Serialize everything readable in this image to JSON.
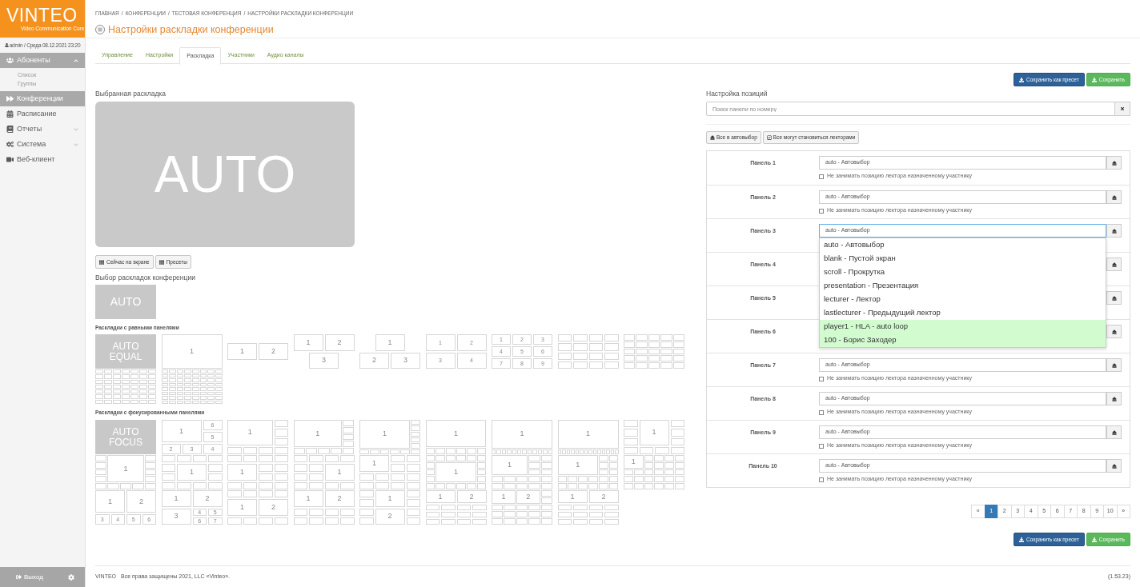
{
  "sidebar": {
    "logo": {
      "text": "VINTEO",
      "tagline": "Video Communication Core"
    },
    "user": "admin / Среда 08.12.2021 23:20",
    "nav": [
      {
        "label": "Абоненты",
        "selected": true,
        "expanded": true,
        "children": [
          {
            "label": "Список",
            "selected": false
          },
          {
            "label": "Группы",
            "selected": false
          }
        ]
      },
      {
        "label": "Конференции",
        "selected": true
      },
      {
        "label": "Расписание",
        "selected": false
      },
      {
        "label": "Отчеты",
        "selected": false,
        "expanded": false
      },
      {
        "label": "Система",
        "selected": false,
        "expanded": false
      },
      {
        "label": "Веб-клиент",
        "selected": false
      }
    ],
    "logout": "Выход"
  },
  "breadcrumb": {
    "separator": "/",
    "items": [
      "ГЛАВНАЯ",
      "КОНФЕРЕНЦИИ",
      "ТЕСТОВАЯ КОНФЕРЕНЦИЯ",
      "НАСТРОЙКИ РАСКЛАДКИ КОНФЕРЕНЦИИ"
    ]
  },
  "title": "Настройки раскладки конференции",
  "tabs": [
    {
      "label": "Управление",
      "selected": false
    },
    {
      "label": "Настройки",
      "selected": false
    },
    {
      "label": "Раскладка",
      "selected": true
    },
    {
      "label": "Участники",
      "selected": false
    },
    {
      "label": "Аудио каналы",
      "selected": false
    }
  ],
  "save_actions_top": [
    {
      "label": "Сохранить как пресет",
      "kind": "primary"
    },
    {
      "label": "Сохранить",
      "kind": "success"
    }
  ],
  "selected_layout": {
    "heading": "Выбранная раскладка",
    "preview": "AUTO",
    "buttons": [
      "Сейчас на экране",
      "Пресеты"
    ]
  },
  "layout_picker": {
    "heading": "Выбор раскладок конференции",
    "auto": "AUTO",
    "equal": {
      "label": "Раскладки с равными панелями",
      "layouts": [
        {
          "kind": "auto",
          "text": "AUTO EQUAL"
        },
        {
          "kind": "cells",
          "labels": [
            "1"
          ]
        },
        {
          "kind": "cells",
          "labels": [
            "1",
            "2"
          ]
        },
        {
          "kind": "cells",
          "labels": [
            "1",
            "2",
            "3"
          ]
        },
        {
          "kind": "cells",
          "labels": [
            "1",
            "2",
            "3"
          ]
        },
        {
          "kind": "cells",
          "labels": [
            "1",
            "2",
            "3",
            "4"
          ]
        },
        {
          "kind": "cells",
          "labels": [
            "1",
            "2",
            "3",
            "4",
            "5",
            "6",
            "7",
            "8",
            "9"
          ]
        },
        {
          "kind": "cells"
        },
        {
          "kind": "cells"
        },
        {
          "kind": "cells"
        },
        {
          "kind": "cells"
        }
      ]
    },
    "focus": {
      "label": "Раскладки с фокусированными панелями",
      "layouts": [
        {
          "kind": "auto",
          "text": "AUTO FOCUS"
        },
        {
          "kind": "cells",
          "labels": [
            "1",
            "6",
            "5",
            "2",
            "3",
            "4"
          ]
        },
        {
          "kind": "cells",
          "labels": [
            "1"
          ]
        },
        {
          "kind": "cells",
          "labels": [
            "1"
          ]
        },
        {
          "kind": "cells",
          "labels": [
            "1"
          ]
        },
        {
          "kind": "cells",
          "labels": [
            "1"
          ]
        },
        {
          "kind": "cells",
          "labels": [
            "1"
          ]
        },
        {
          "kind": "cells",
          "labels": [
            "1"
          ]
        },
        {
          "kind": "cells",
          "labels": [
            "1"
          ]
        },
        {
          "kind": "cells",
          "labels": [
            "1"
          ]
        },
        {
          "kind": "cells",
          "labels": [
            "1"
          ]
        },
        {
          "kind": "cells",
          "labels": [
            "1"
          ]
        },
        {
          "kind": "cells",
          "labels": [
            "1"
          ]
        },
        {
          "kind": "cells",
          "labels": [
            "1"
          ]
        },
        {
          "kind": "cells",
          "labels": [
            "1"
          ]
        },
        {
          "kind": "cells",
          "labels": [
            "1"
          ]
        },
        {
          "kind": "cells",
          "labels": [
            "1"
          ]
        },
        {
          "kind": "cells",
          "labels": [
            "1"
          ]
        },
        {
          "kind": "cells",
          "labels": [
            "1",
            "2",
            "3",
            "4",
            "5",
            "6"
          ]
        },
        {
          "kind": "cells",
          "labels": [
            "1",
            "2",
            "3",
            "4",
            "5",
            "6",
            "7"
          ]
        },
        {
          "kind": "cells",
          "labels": [
            "1",
            "2"
          ]
        },
        {
          "kind": "cells",
          "labels": [
            "1",
            "2"
          ]
        },
        {
          "kind": "cells",
          "labels": [
            "1",
            "2"
          ]
        },
        {
          "kind": "cells",
          "labels": [
            "1",
            "2"
          ]
        },
        {
          "kind": "cells",
          "labels": [
            "1",
            "2"
          ]
        },
        {
          "kind": "cells",
          "labels": [
            "1",
            "2"
          ]
        }
      ]
    }
  },
  "positions": {
    "heading": "Настройка позиций",
    "search": {
      "placeholder": "Поиск панели по номеру"
    },
    "bulk_actions": [
      {
        "label": "Все в автовыбор",
        "kind": "auto"
      },
      {
        "label": "Все могут становиться лекторами",
        "kind": "lecturers"
      }
    ],
    "panels": [
      {
        "label": "Панель 1",
        "value": "auto - Автовыбор",
        "focused": false,
        "option": {
          "label": "Не занимать позицию лектора назначенному участнику",
          "checked": false
        }
      },
      {
        "label": "Панель 2",
        "value": "auto - Автовыбор",
        "focused": false,
        "option": {
          "label": "Не занимать позицию лектора назначенному участнику",
          "checked": false
        }
      },
      {
        "label": "Панель 3",
        "value": "auto - Автовыбор",
        "focused": true,
        "dropdown": [
          {
            "label": "auto - Автовыбор",
            "kind": "mode"
          },
          {
            "label": "blank - Пустой экран",
            "kind": "mode"
          },
          {
            "label": "scroll - Прокрутка",
            "kind": "mode"
          },
          {
            "label": "presentation - Презентация",
            "kind": "mode"
          },
          {
            "label": "lecturer - Лектор",
            "kind": "mode"
          },
          {
            "label": "lastlecturer - Предыдущий лектор",
            "kind": "mode"
          },
          {
            "label": "player1 - HLA - auto loop",
            "kind": "participant"
          },
          {
            "label": "100 - Борис Заходер",
            "kind": "participant"
          }
        ]
      },
      {
        "label": "Панель 4"
      },
      {
        "label": "Панель 5"
      },
      {
        "label": "Панель 6"
      },
      {
        "label": "Панель 7",
        "value": "auto - Автовыбор",
        "focused": false,
        "option": {
          "label": "Не занимать позицию лектора назначенному участнику",
          "checked": false
        }
      },
      {
        "label": "Панель 8",
        "value": "auto - Автовыбор",
        "focused": false,
        "option": {
          "label": "Не занимать позицию лектора назначенному участнику",
          "checked": false
        }
      },
      {
        "label": "Панель 9",
        "value": "auto - Автовыбор",
        "focused": false,
        "option": {
          "label": "Не занимать позицию лектора назначенному участнику",
          "checked": false
        }
      },
      {
        "label": "Панель 10",
        "value": "auto - Автовыбор",
        "focused": false,
        "option": {
          "label": "Не занимать позицию лектора назначенному участнику",
          "checked": false
        }
      }
    ],
    "pagination": [
      {
        "label": "«",
        "selected": false
      },
      {
        "label": "1",
        "selected": true
      },
      {
        "label": "2",
        "selected": false
      },
      {
        "label": "3",
        "selected": false
      },
      {
        "label": "4",
        "selected": false
      },
      {
        "label": "5",
        "selected": false
      },
      {
        "label": "6",
        "selected": false
      },
      {
        "label": "7",
        "selected": false
      },
      {
        "label": "8",
        "selected": false
      },
      {
        "label": "9",
        "selected": false
      },
      {
        "label": "10",
        "selected": false
      },
      {
        "label": "»",
        "selected": false
      }
    ]
  },
  "save_actions_bottom": [
    {
      "label": "Сохранить как пресет",
      "kind": "primary"
    },
    {
      "label": "Сохранить",
      "kind": "success"
    }
  ],
  "footer": {
    "brand": "VINTEO",
    "copyright": "Все права защищены 2021, LLC «Vinteo».",
    "version": "(1.53.23)"
  }
}
